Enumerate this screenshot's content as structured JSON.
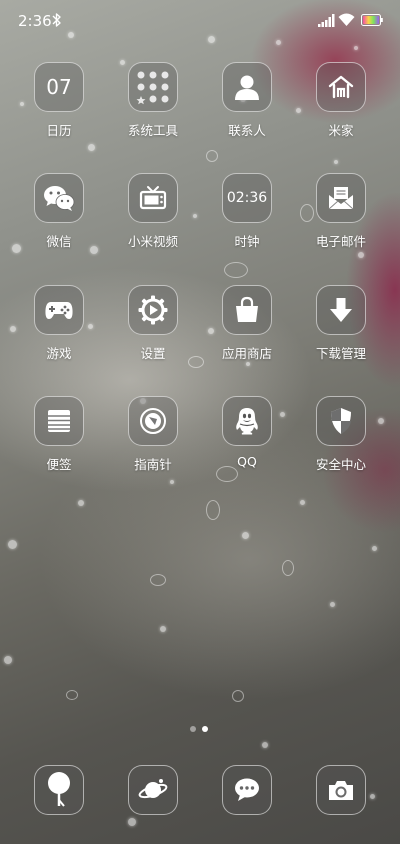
{
  "status_bar": {
    "time": "2:36",
    "icons": [
      "bluetooth-icon",
      "signal-icon",
      "wifi-icon",
      "battery-icon"
    ]
  },
  "apps": [
    {
      "label": "日历",
      "icon": "calendar-icon",
      "tile_text": "07"
    },
    {
      "label": "系统工具",
      "icon": "system-tools-folder-icon"
    },
    {
      "label": "联系人",
      "icon": "contacts-icon"
    },
    {
      "label": "米家",
      "icon": "mijia-home-icon"
    },
    {
      "label": "微信",
      "icon": "wechat-icon"
    },
    {
      "label": "小米视频",
      "icon": "tv-icon"
    },
    {
      "label": "时钟",
      "icon": "clock-icon",
      "tile_text": "02:36"
    },
    {
      "label": "电子邮件",
      "icon": "email-icon"
    },
    {
      "label": "游戏",
      "icon": "gamepad-icon"
    },
    {
      "label": "设置",
      "icon": "gear-icon"
    },
    {
      "label": "应用商店",
      "icon": "shopping-bag-icon"
    },
    {
      "label": "下载管理",
      "icon": "download-arrow-icon"
    },
    {
      "label": "便签",
      "icon": "notes-icon"
    },
    {
      "label": "指南针",
      "icon": "compass-icon"
    },
    {
      "label": "QQ",
      "icon": "qq-penguin-icon"
    },
    {
      "label": "安全中心",
      "icon": "shield-icon"
    }
  ],
  "page_indicator": {
    "total": 2,
    "current": 2
  },
  "dock": [
    {
      "icon": "browser-icon"
    },
    {
      "icon": "planet-icon"
    },
    {
      "icon": "message-bubble-icon"
    },
    {
      "icon": "camera-icon"
    }
  ],
  "colors": {
    "icon_tile_bg": "#55555559",
    "icon_tile_border": "#ffffff8c",
    "text": "#ffffff"
  }
}
